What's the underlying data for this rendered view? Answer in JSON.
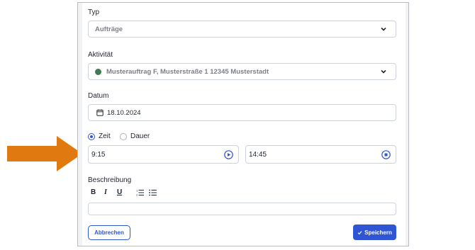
{
  "form": {
    "typ": {
      "label": "Typ",
      "value": "Aufträge"
    },
    "aktivitaet": {
      "label": "Aktivität",
      "value": "Musterauftrag F, Musterstraße 1 12345 Musterstadt",
      "status_color": "#3f7a55"
    },
    "datum": {
      "label": "Datum",
      "value": "18.10.2024"
    },
    "mode": {
      "options": [
        "Zeit",
        "Dauer"
      ],
      "selected": "Zeit"
    },
    "time": {
      "start": "9:15",
      "end": "14:45"
    },
    "beschreibung": {
      "label": "Beschreibung",
      "toolbar": [
        "bold-icon",
        "italic-icon",
        "underline-icon",
        "ordered-list-icon",
        "bullet-list-icon"
      ],
      "value": ""
    },
    "actions": {
      "cancel": "Abbrechen",
      "save": "Speichern"
    }
  },
  "colors": {
    "accent": "#2f55d4",
    "arrow": "#e07a10"
  }
}
